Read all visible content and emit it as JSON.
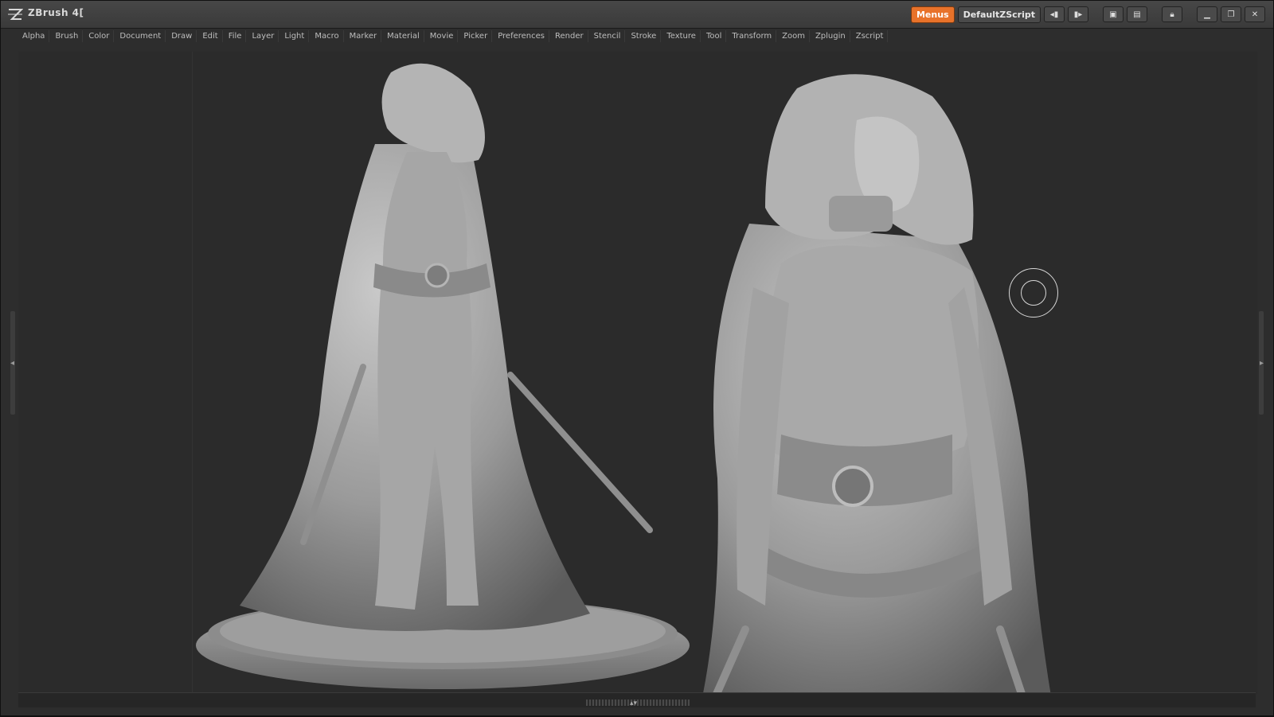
{
  "titlebar": {
    "app_title": "ZBrush 4[",
    "menus_label": "Menus",
    "script_label": "DefaultZScript",
    "buttons": [
      "slider-left-icon",
      "slider-right-icon",
      "window-layout-icon",
      "window-layout-alt-icon",
      "lock-icon",
      "minimize-icon",
      "restore-icon",
      "close-icon"
    ]
  },
  "menubar": {
    "items": [
      "Alpha",
      "Brush",
      "Color",
      "Document",
      "Draw",
      "Edit",
      "File",
      "Layer",
      "Light",
      "Macro",
      "Marker",
      "Material",
      "Movie",
      "Picker",
      "Preferences",
      "Render",
      "Stencil",
      "Stroke",
      "Texture",
      "Tool",
      "Transform",
      "Zoom",
      "Zplugin",
      "Zscript"
    ]
  },
  "colors": {
    "accent": "#e8722a",
    "background": "#2d2d2d",
    "titlebar": "#3f3f3f",
    "model": "#9a9a9a"
  }
}
